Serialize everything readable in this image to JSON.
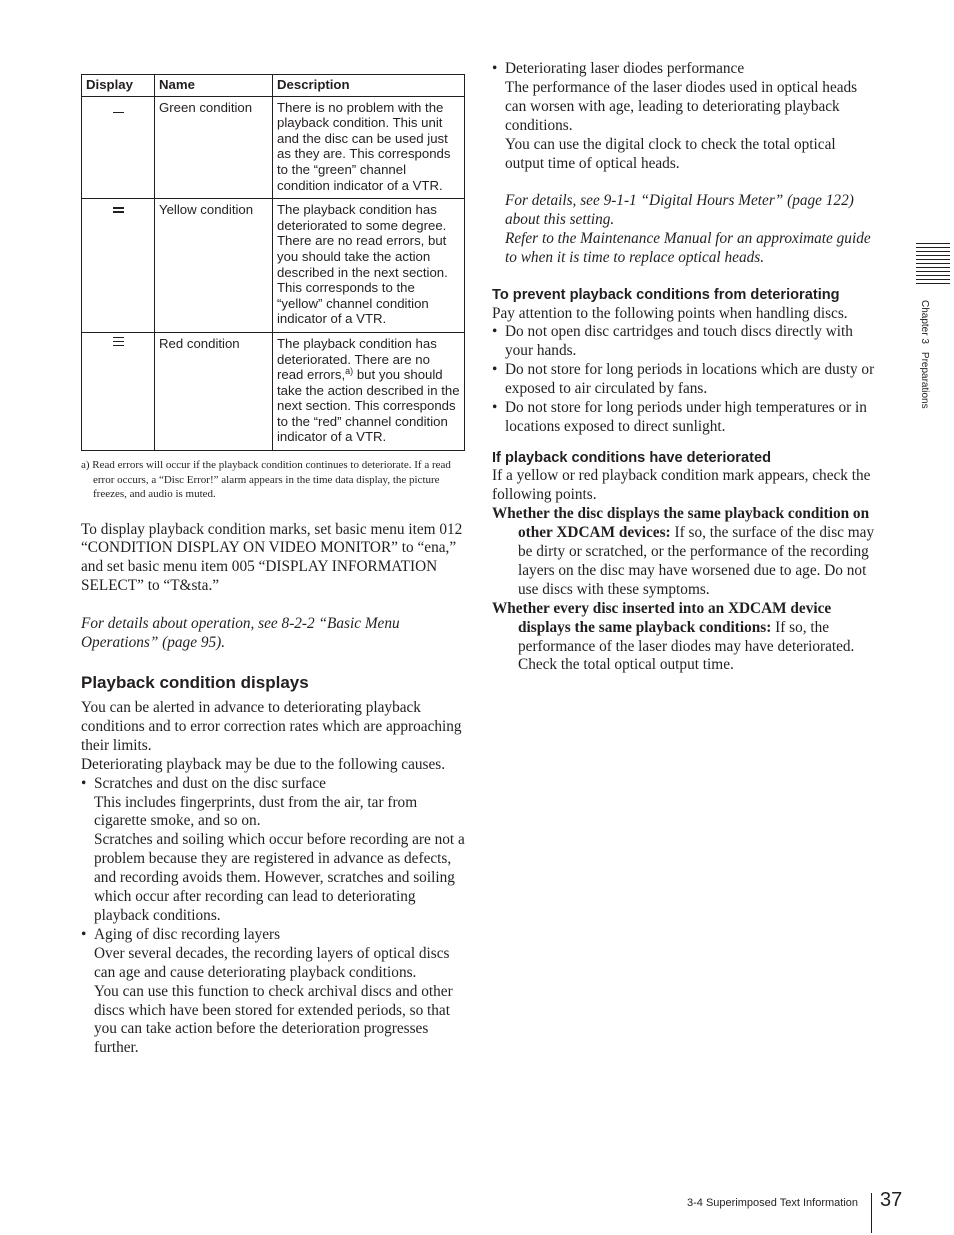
{
  "table": {
    "headers": [
      "Display",
      "Name",
      "Description"
    ],
    "rows": [
      {
        "mark": "single-line-mark",
        "name": "Green condition",
        "description": "There is no problem with the playback condition. This unit and the disc can be used just as they are. This corresponds to the “green” channel condition indicator of a VTR."
      },
      {
        "mark": "double-line-mark",
        "name": "Yellow condition",
        "description": "The playback condition has deteriorated to some degree. There are no read errors, but you should take the action described in the next section. This corresponds to the “yellow” channel condition indicator of a VTR."
      },
      {
        "mark": "triple-line-mark",
        "name": "Red condition",
        "description_pre": "The playback condition has deteriorated. There are no read errors,",
        "description_sup": "a)",
        "description_post": " but you should take the action described in the next section. This corresponds to the “red” channel condition indicator of a VTR."
      }
    ],
    "footnote": "a) Read errors will occur if the playback condition continues to deteriorate. If a read error occurs, a “Disc Error!” alarm appears in the time data display, the picture freezes, and audio is muted."
  },
  "left": {
    "intro": "To display playback condition marks, set basic menu item 012 “CONDITION DISPLAY ON VIDEO MONITOR” to “ena,” and set basic menu item 005 “DISPLAY INFORMATION SELECT” to “T&sta.”",
    "xref": "For details about operation, see 8-2-2 “Basic Menu Operations” (page 95).",
    "section_title": "Playback condition displays",
    "para1": "You can be alerted in advance to deteriorating playback conditions and to error correction rates which are approaching their limits.",
    "para2": "Deteriorating playback may be due to the following causes.",
    "bullets": [
      {
        "title": "Scratches and dust on the disc surface",
        "lines": [
          "This includes fingerprints, dust from the air, tar from cigarette smoke, and so on.",
          "Scratches and soiling which occur before recording are not a problem because they are registered in advance as defects, and recording avoids them. However, scratches and soiling which occur after recording can lead to deteriorating playback conditions."
        ]
      },
      {
        "title": "Aging of disc recording layers",
        "lines": [
          "Over several decades, the recording layers of optical discs can age and cause deteriorating playback conditions.",
          "You can use this function to check archival discs and other discs which have been stored for extended periods, so that you can take action before the deterioration progresses further."
        ]
      }
    ]
  },
  "right": {
    "bullet": {
      "title": "Deteriorating laser diodes performance",
      "lines": [
        "The performance of the laser diodes used in optical heads can worsen with age, leading to deteriorating playback conditions.",
        "You can use the digital clock to check the total optical output time of optical heads."
      ],
      "xref1": "For details, see 9-1-1 “Digital Hours Meter” (page 122) about this setting.",
      "xref2": "Refer to the Maintenance Manual for an approximate guide to when it is time to replace optical heads."
    },
    "prevent": {
      "title": "To prevent playback conditions from deteriorating",
      "intro": "Pay attention to the following points when handling discs.",
      "bullets": [
        "Do not open disc cartridges and touch discs directly with your hands.",
        "Do not store for long periods in locations which are dusty or exposed to air circulated by fans.",
        "Do not store for long periods under high temperatures or in locations exposed to direct sunlight."
      ]
    },
    "deteriorated": {
      "title": "If playback conditions have deteriorated",
      "intro": "If a yellow or red playback condition mark appears, check the following points.",
      "items": [
        {
          "term": "Whether the disc displays the same playback condition on other XDCAM devices:",
          "text": " If so, the surface of the disc may be dirty or scratched, or the performance of the recording layers on the disc may have worsened due to age. Do not use discs with these symptoms."
        },
        {
          "term": "Whether every disc inserted into an XDCAM device displays the same playback conditions:",
          "text": " If so, the performance of the laser diodes may have deteriorated. Check the total optical output time."
        }
      ]
    }
  },
  "side_tab": {
    "chapter": "Chapter 3",
    "title": "Preparations"
  },
  "footer": {
    "section": "3-4 Superimposed Text Information",
    "page_number": "37"
  },
  "bullet_glyph": "•"
}
